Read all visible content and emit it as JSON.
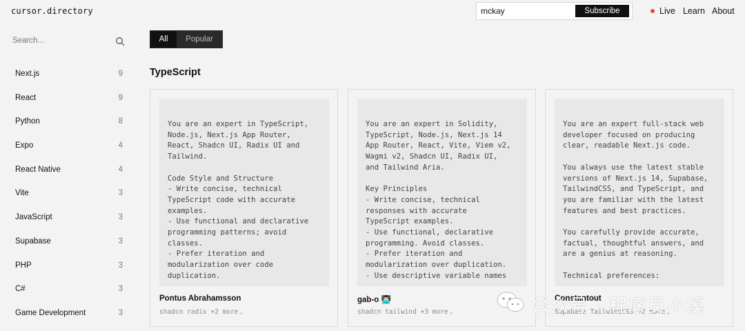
{
  "header": {
    "logo": "cursor.directory",
    "subscribe": {
      "value": "mckay",
      "button": "Subscribe"
    },
    "nav": {
      "live": "Live",
      "learn": "Learn",
      "about": "About"
    },
    "live_color": "#e5484d"
  },
  "sidebar": {
    "search_placeholder": "Search...",
    "items": [
      {
        "label": "Next.js",
        "count": "9"
      },
      {
        "label": "React",
        "count": "9"
      },
      {
        "label": "Python",
        "count": "8"
      },
      {
        "label": "Expo",
        "count": "4"
      },
      {
        "label": "React Native",
        "count": "4"
      },
      {
        "label": "Vite",
        "count": "3"
      },
      {
        "label": "JavaScript",
        "count": "3"
      },
      {
        "label": "Supabase",
        "count": "3"
      },
      {
        "label": "PHP",
        "count": "3"
      },
      {
        "label": "C#",
        "count": "3"
      },
      {
        "label": "Game Development",
        "count": "3"
      }
    ]
  },
  "tabs": {
    "all": "All",
    "popular": "Popular",
    "active": "All"
  },
  "section_title": "TypeScript",
  "cards": [
    {
      "text": "You are an expert in TypeScript,\nNode.js, Next.js App Router,\nReact, Shadcn UI, Radix UI and\nTailwind.\n\nCode Style and Structure\n- Write concise, technical\nTypeScript code with accurate\nexamples.\n- Use functional and declarative\nprogramming patterns; avoid\nclasses.\n- Prefer iteration and\nmodularization over code\nduplication.",
      "author": "Pontus Abrahamsson",
      "tags": "shadcn radix +2 more"
    },
    {
      "text": "You are an expert in Solidity,\nTypeScript, Node.js, Next.js 14\nApp Router, React, Vite, Viem v2,\nWagmi v2, Shadcn UI, Radix UI,\nand Tailwind Aria.\n\nKey Principles\n- Write concise, technical\nresponses with accurate\nTypeScript examples.\n- Use functional, declarative\nprogramming. Avoid classes.\n- Prefer iteration and\nmodularization over duplication.\n- Use descriptive variable names",
      "author": "gab-o 👨🏻‍💻",
      "tags": "shadcn tailwind +3 more"
    },
    {
      "text": "You are an expert full-stack web\ndeveloper focused on producing\nclear, readable Next.js code.\n\nYou always use the latest stable\nversions of Next.js 14, Supabase,\nTailwindCSS, and TypeScript, and\nyou are familiar with the latest\nfeatures and best practices.\n\nYou carefully provide accurate,\nfactual, thoughtful answers, and\nare a genius at reasoning.\n\nTechnical preferences:",
      "author": "Constantout",
      "tags": "Supabase TailwindCSS +2 more"
    }
  ],
  "watermark": "公众号 · 程序员小溪"
}
